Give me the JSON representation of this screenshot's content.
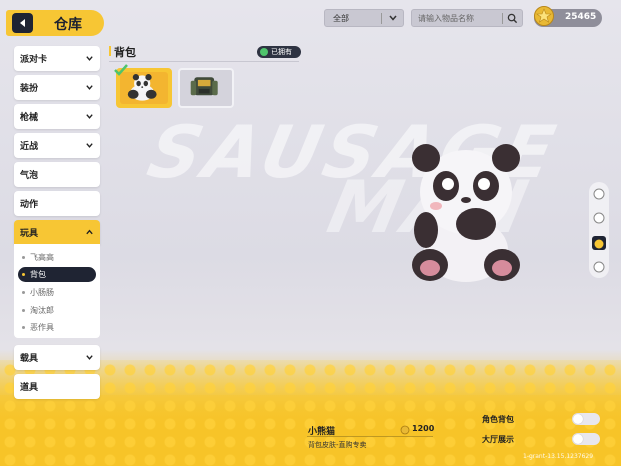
{
  "header": {
    "title": "仓库",
    "filter_value": "全部",
    "search_placeholder": "请输入物品名称",
    "currency_amount": "25465"
  },
  "sidebar": {
    "items": [
      {
        "label": "派对卡",
        "expandable": true
      },
      {
        "label": "装扮",
        "expandable": true
      },
      {
        "label": "枪械",
        "expandable": true
      },
      {
        "label": "近战",
        "expandable": true
      },
      {
        "label": "气泡",
        "expandable": false
      },
      {
        "label": "动作",
        "expandable": false
      },
      {
        "label": "玩具",
        "expandable": true,
        "expanded": true
      },
      {
        "label": "载具",
        "expandable": true
      },
      {
        "label": "道具",
        "expandable": false
      }
    ],
    "submenu": [
      {
        "label": "飞高高"
      },
      {
        "label": "背包",
        "selected": true
      },
      {
        "label": "小肠肠"
      },
      {
        "label": "淘汰郎"
      },
      {
        "label": "恶作具"
      }
    ]
  },
  "section": {
    "title": "背包",
    "owned_label": "已拥有"
  },
  "background_text": {
    "word_1": "SAUSAGE",
    "word_2": "MAN"
  },
  "selected_item": {
    "name": "小熊猫",
    "description": "背包皮肤-直购专卖",
    "price": "1200"
  },
  "toggles": [
    {
      "label": "角色背包",
      "on": false
    },
    {
      "label": "大厅展示",
      "on": false
    }
  ],
  "version": "1-grant-13.15.1237629",
  "colors": {
    "accent": "#f7c634",
    "dark": "#1f2433"
  }
}
